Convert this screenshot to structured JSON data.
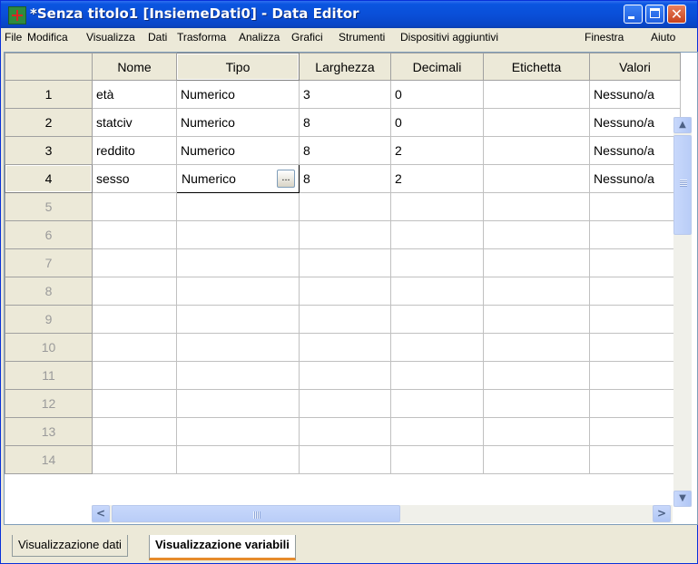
{
  "window": {
    "title": "*Senza titolo1 [InsiemeDati0] - Data Editor",
    "close_glyph": "✕"
  },
  "menu": [
    "File",
    "Modifica",
    "Visualizza",
    "Dati",
    "Trasforma",
    "Analizza",
    "Grafici",
    "Strumenti",
    "Dispositivi aggiuntivi",
    "Finestra",
    "Aiuto"
  ],
  "grid": {
    "columns": [
      "Nome",
      "Tipo",
      "Larghezza",
      "Decimali",
      "Etichetta",
      "Valori"
    ],
    "rows": [
      {
        "num": "1",
        "nome": "età",
        "tipo": "Numerico",
        "larghezza": "3",
        "decimali": "0",
        "etichetta": "",
        "valori": "Nessuno/a"
      },
      {
        "num": "2",
        "nome": "statciv",
        "tipo": "Numerico",
        "larghezza": "8",
        "decimali": "0",
        "etichetta": "",
        "valori": "Nessuno/a"
      },
      {
        "num": "3",
        "nome": "reddito",
        "tipo": "Numerico",
        "larghezza": "8",
        "decimali": "2",
        "etichetta": "",
        "valori": "Nessuno/a"
      },
      {
        "num": "4",
        "nome": "sesso",
        "tipo": "Numerico",
        "larghezza": "8",
        "decimali": "2",
        "etichetta": "",
        "valori": "Nessuno/a"
      }
    ],
    "empty_rows": [
      "5",
      "6",
      "7",
      "8",
      "9",
      "10",
      "11",
      "12",
      "13",
      "14"
    ],
    "tipo_button": "..."
  },
  "tabs": {
    "data_view": "Visualizzazione dati",
    "variable_view": "Visualizzazione variabili"
  },
  "scroll": {
    "up": "▲",
    "down": "▼",
    "left": "<",
    "right": ">"
  }
}
